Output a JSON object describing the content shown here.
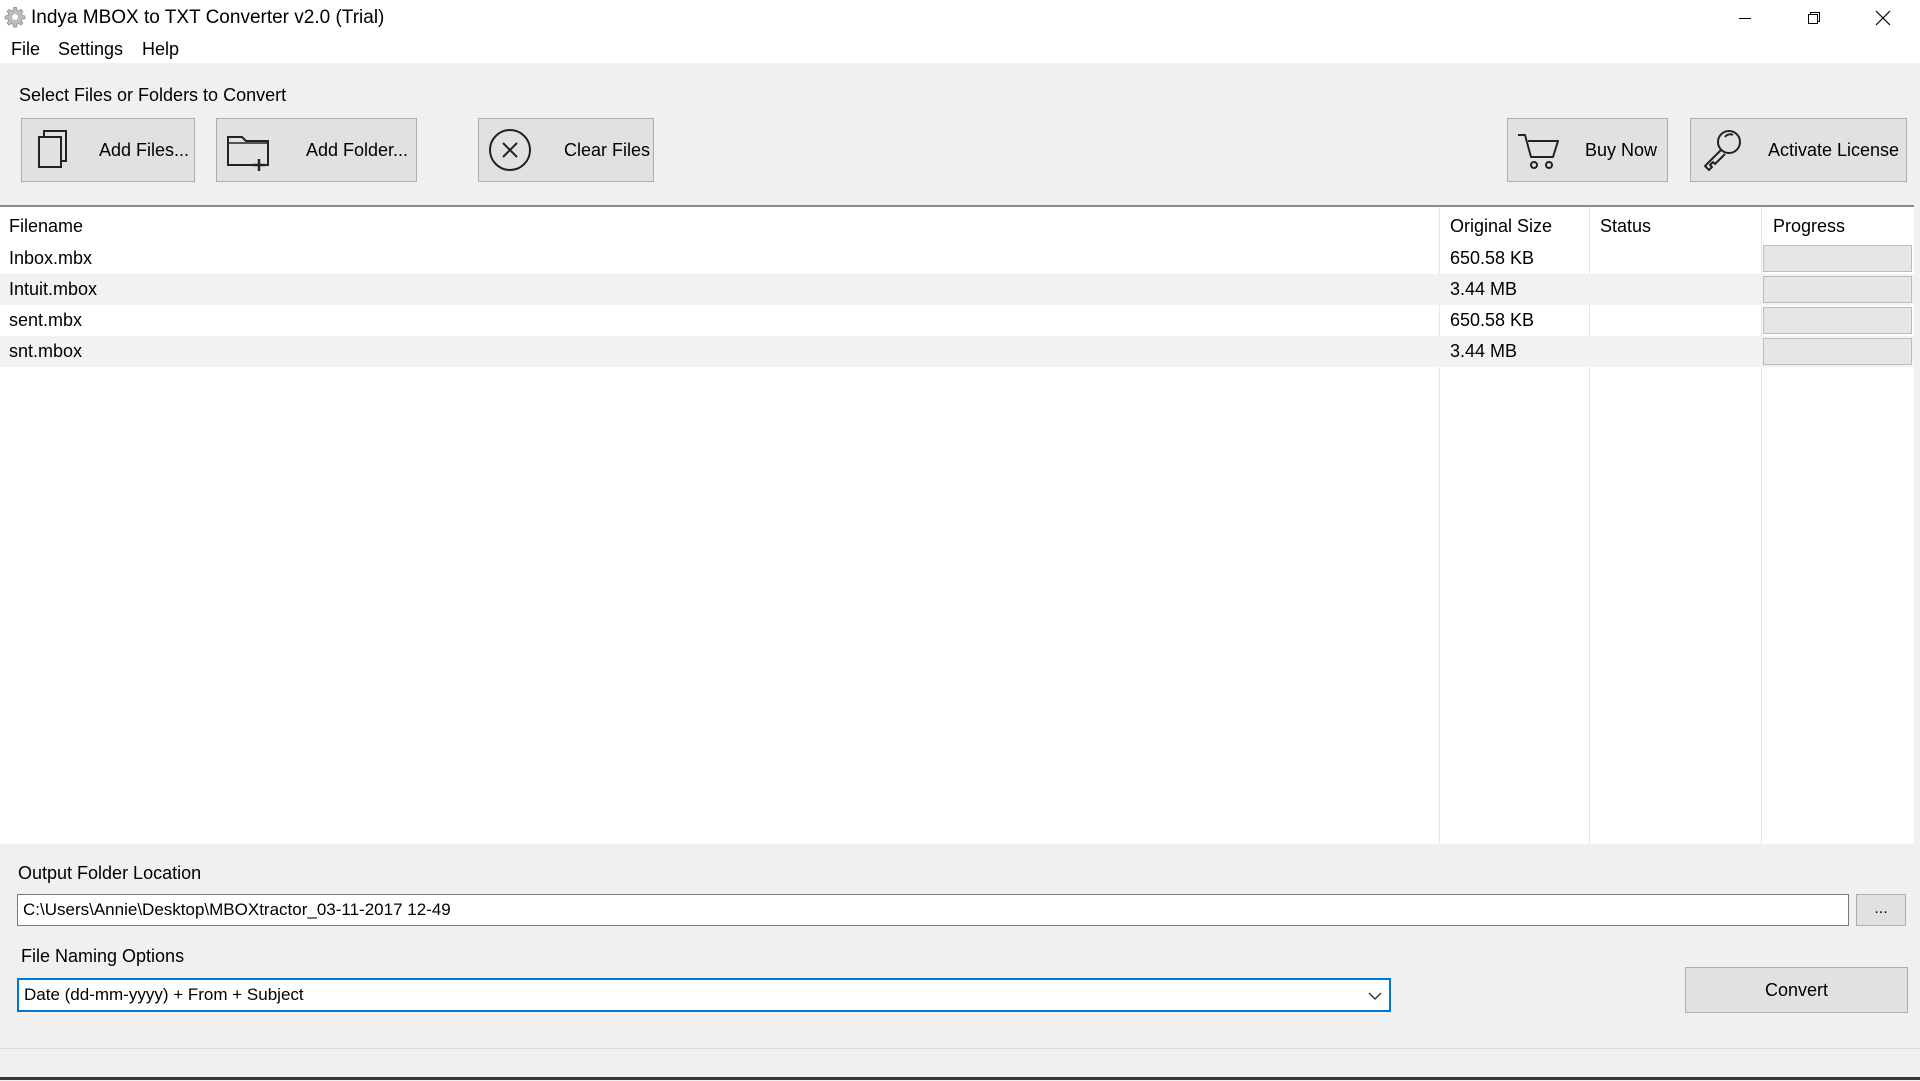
{
  "window": {
    "title": "Indya MBOX to TXT Converter v2.0 (Trial)",
    "app_icon": "gear-icon",
    "controls": [
      "minimize-icon",
      "restore-icon",
      "close-icon"
    ]
  },
  "menu": {
    "file": "File",
    "settings": "Settings",
    "help": "Help"
  },
  "toolbar": {
    "heading": "Select Files or Folders to Convert",
    "add_files": "Add Files...",
    "add_folder": "Add Folder...",
    "clear_files": "Clear Files",
    "buy_now": "Buy Now",
    "activate_license": "Activate License"
  },
  "table": {
    "columns": {
      "filename": "Filename",
      "original_size": "Original Size",
      "status": "Status",
      "progress": "Progress"
    },
    "rows": [
      {
        "filename": "Inbox.mbx",
        "size": "650.58 KB",
        "status": "",
        "progress": 0
      },
      {
        "filename": "Intuit.mbox",
        "size": "3.44 MB",
        "status": "",
        "progress": 0
      },
      {
        "filename": "sent.mbx",
        "size": "650.58 KB",
        "status": "",
        "progress": 0
      },
      {
        "filename": "snt.mbox",
        "size": "3.44 MB",
        "status": "",
        "progress": 0
      }
    ]
  },
  "output": {
    "label": "Output Folder Location",
    "path": "C:\\Users\\Annie\\Desktop\\MBOXtractor_03-11-2017 12-49",
    "browse_label": "..."
  },
  "naming": {
    "label": "File Naming Options",
    "selected": "Date (dd-mm-yyyy) + From + Subject"
  },
  "convert_label": "Convert",
  "colors": {
    "focus_border": "#0078d7",
    "button_face": "#e1e1e1",
    "window_bg": "#f0f0f0"
  }
}
